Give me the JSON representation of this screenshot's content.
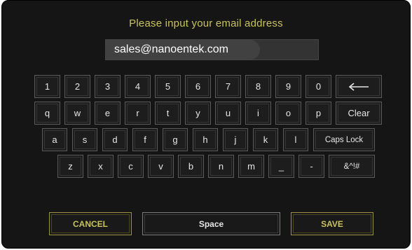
{
  "title": "Please input your email address",
  "email": {
    "value": "sales@nanoentek.com"
  },
  "keyboard": {
    "row1": [
      "1",
      "2",
      "3",
      "4",
      "5",
      "6",
      "7",
      "8",
      "9",
      "0"
    ],
    "backspace_icon": "left-arrow",
    "row2": [
      "q",
      "w",
      "e",
      "r",
      "t",
      "y",
      "u",
      "i",
      "o",
      "p"
    ],
    "clear_label": "Clear",
    "row3": [
      "a",
      "s",
      "d",
      "f",
      "g",
      "h",
      "j",
      "k",
      "l"
    ],
    "caps_label": "Caps Lock",
    "row4": [
      "z",
      "x",
      "c",
      "v",
      "b",
      "n",
      "m",
      "_",
      "-"
    ],
    "symbols_label": "&^!#"
  },
  "buttons": {
    "cancel_label": "CANCEL",
    "space_label": "Space",
    "save_label": "SAVE"
  },
  "colors": {
    "title": "#c9c25e",
    "accent": "#c9c25e",
    "background": "#151515",
    "key_text": "#e6e6e6"
  }
}
